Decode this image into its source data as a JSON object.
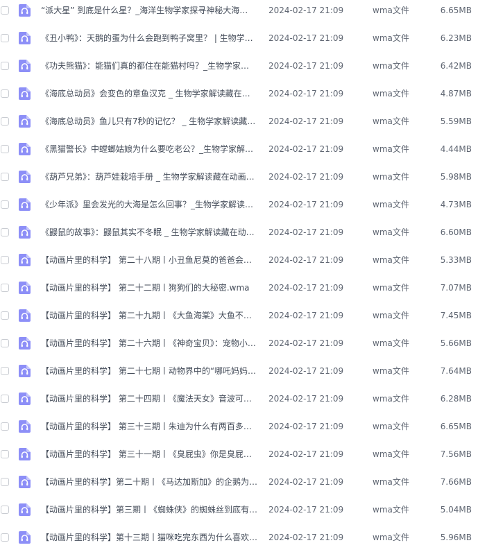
{
  "colors": {
    "icon_bg": "#8d8ff7",
    "text": "#454d5a",
    "meta_text": "#5f6672",
    "checkbox_border": "#c9ccd2"
  },
  "files": [
    {
      "name": "“派大星” 到底是什么星？_海洋生物学家探寻神秘大海…",
      "date": "2024-02-17 21:09",
      "type": "wma文件",
      "size": "6.65MB",
      "icon": "audio-headphones-icon"
    },
    {
      "name": "《丑小鸭》：天鹅的蛋为什么会跑到鸭子窝里？ | 生物学…",
      "date": "2024-02-17 21:09",
      "type": "wma文件",
      "size": "6.23MB",
      "icon": "audio-headphones-icon"
    },
    {
      "name": "《功夫熊猫》：能猫们真的都住在能猫村吗？_生物学家…",
      "date": "2024-02-17 21:09",
      "type": "wma文件",
      "size": "6.42MB",
      "icon": "audio-headphones-icon"
    },
    {
      "name": "《海底总动员》会变色的章鱼汉克 _ 生物学家解读藏在动…",
      "date": "2024-02-17 21:09",
      "type": "wma文件",
      "size": "4.87MB",
      "icon": "audio-headphones-icon"
    },
    {
      "name": "《海底总动员》鱼儿只有7秒的记忆？ _ 生物学家解读藏…",
      "date": "2024-02-17 21:09",
      "type": "wma文件",
      "size": "5.59MB",
      "icon": "audio-headphones-icon"
    },
    {
      "name": "《黑猫警长》中螳螂姑娘为什么要吃老公？_生物学家解…",
      "date": "2024-02-17 21:09",
      "type": "wma文件",
      "size": "4.44MB",
      "icon": "audio-headphones-icon"
    },
    {
      "name": "《葫芦兄弟》：葫芦娃栽培手册 _ 生物学家解读藏在动画…",
      "date": "2024-02-17 21:09",
      "type": "wma文件",
      "size": "5.98MB",
      "icon": "audio-headphones-icon"
    },
    {
      "name": "《少年派》里会发光的大海是怎么回事？_生物学家解读…",
      "date": "2024-02-17 21:09",
      "type": "wma文件",
      "size": "4.73MB",
      "icon": "audio-headphones-icon"
    },
    {
      "name": "《鼹鼠的故事》：鼹鼠其实不冬眠 _ 生物学家解读藏在动…",
      "date": "2024-02-17 21:09",
      "type": "wma文件",
      "size": "6.60MB",
      "icon": "audio-headphones-icon"
    },
    {
      "name": "【动画片里的科学】 第二十八期丨小丑鱼尼莫的爸爸会变…",
      "date": "2024-02-17 21:09",
      "type": "wma文件",
      "size": "5.33MB",
      "icon": "audio-headphones-icon"
    },
    {
      "name": "【动画片里的科学】 第二十二期丨狗狗们的大秘密.wma",
      "date": "2024-02-17 21:09",
      "type": "wma文件",
      "size": "7.07MB",
      "icon": "audio-headphones-icon"
    },
    {
      "name": "【动画片里的科学】 第二十九期丨《大鱼海棠》大鱼不是…",
      "date": "2024-02-17 21:09",
      "type": "wma文件",
      "size": "7.45MB",
      "icon": "audio-headphones-icon"
    },
    {
      "name": "【动画片里的科学】 第二十六期丨《神奇宝贝》：宠物小…",
      "date": "2024-02-17 21:09",
      "type": "wma文件",
      "size": "5.66MB",
      "icon": "audio-headphones-icon"
    },
    {
      "name": "【动画片里的科学】 第二十七期丨动物界中的“哪吒妈妈…",
      "date": "2024-02-17 21:09",
      "type": "wma文件",
      "size": "7.64MB",
      "icon": "audio-headphones-icon"
    },
    {
      "name": "【动画片里的科学】 第二十四期丨《魔法天女》音波可以…",
      "date": "2024-02-17 21:09",
      "type": "wma文件",
      "size": "6.28MB",
      "icon": "audio-headphones-icon"
    },
    {
      "name": "【动画片里的科学】 第三十三期丨朱迪为什么有两百多个…",
      "date": "2024-02-17 21:09",
      "type": "wma文件",
      "size": "6.65MB",
      "icon": "audio-headphones-icon"
    },
    {
      "name": "【动画片里的科学】 第三十一期丨《臭屁虫》你是臭屁虫…",
      "date": "2024-02-17 21:09",
      "type": "wma文件",
      "size": "7.56MB",
      "icon": "audio-headphones-icon"
    },
    {
      "name": "【动画片里的科学】第二十期丨《马达加斯加》的企鹅为…",
      "date": "2024-02-17 21:09",
      "type": "wma文件",
      "size": "7.66MB",
      "icon": "audio-headphones-icon"
    },
    {
      "name": "【动画片里的科学】第三期丨《蜘蛛侠》的蜘蛛丝到底有…",
      "date": "2024-02-17 21:09",
      "type": "wma文件",
      "size": "5.04MB",
      "icon": "audio-headphones-icon"
    },
    {
      "name": "【动画片里的科学】第十三期丨猫咪吃完东西为什么喜欢…",
      "date": "2024-02-17 21:09",
      "type": "wma文件",
      "size": "5.96MB",
      "icon": "audio-headphones-icon"
    }
  ]
}
